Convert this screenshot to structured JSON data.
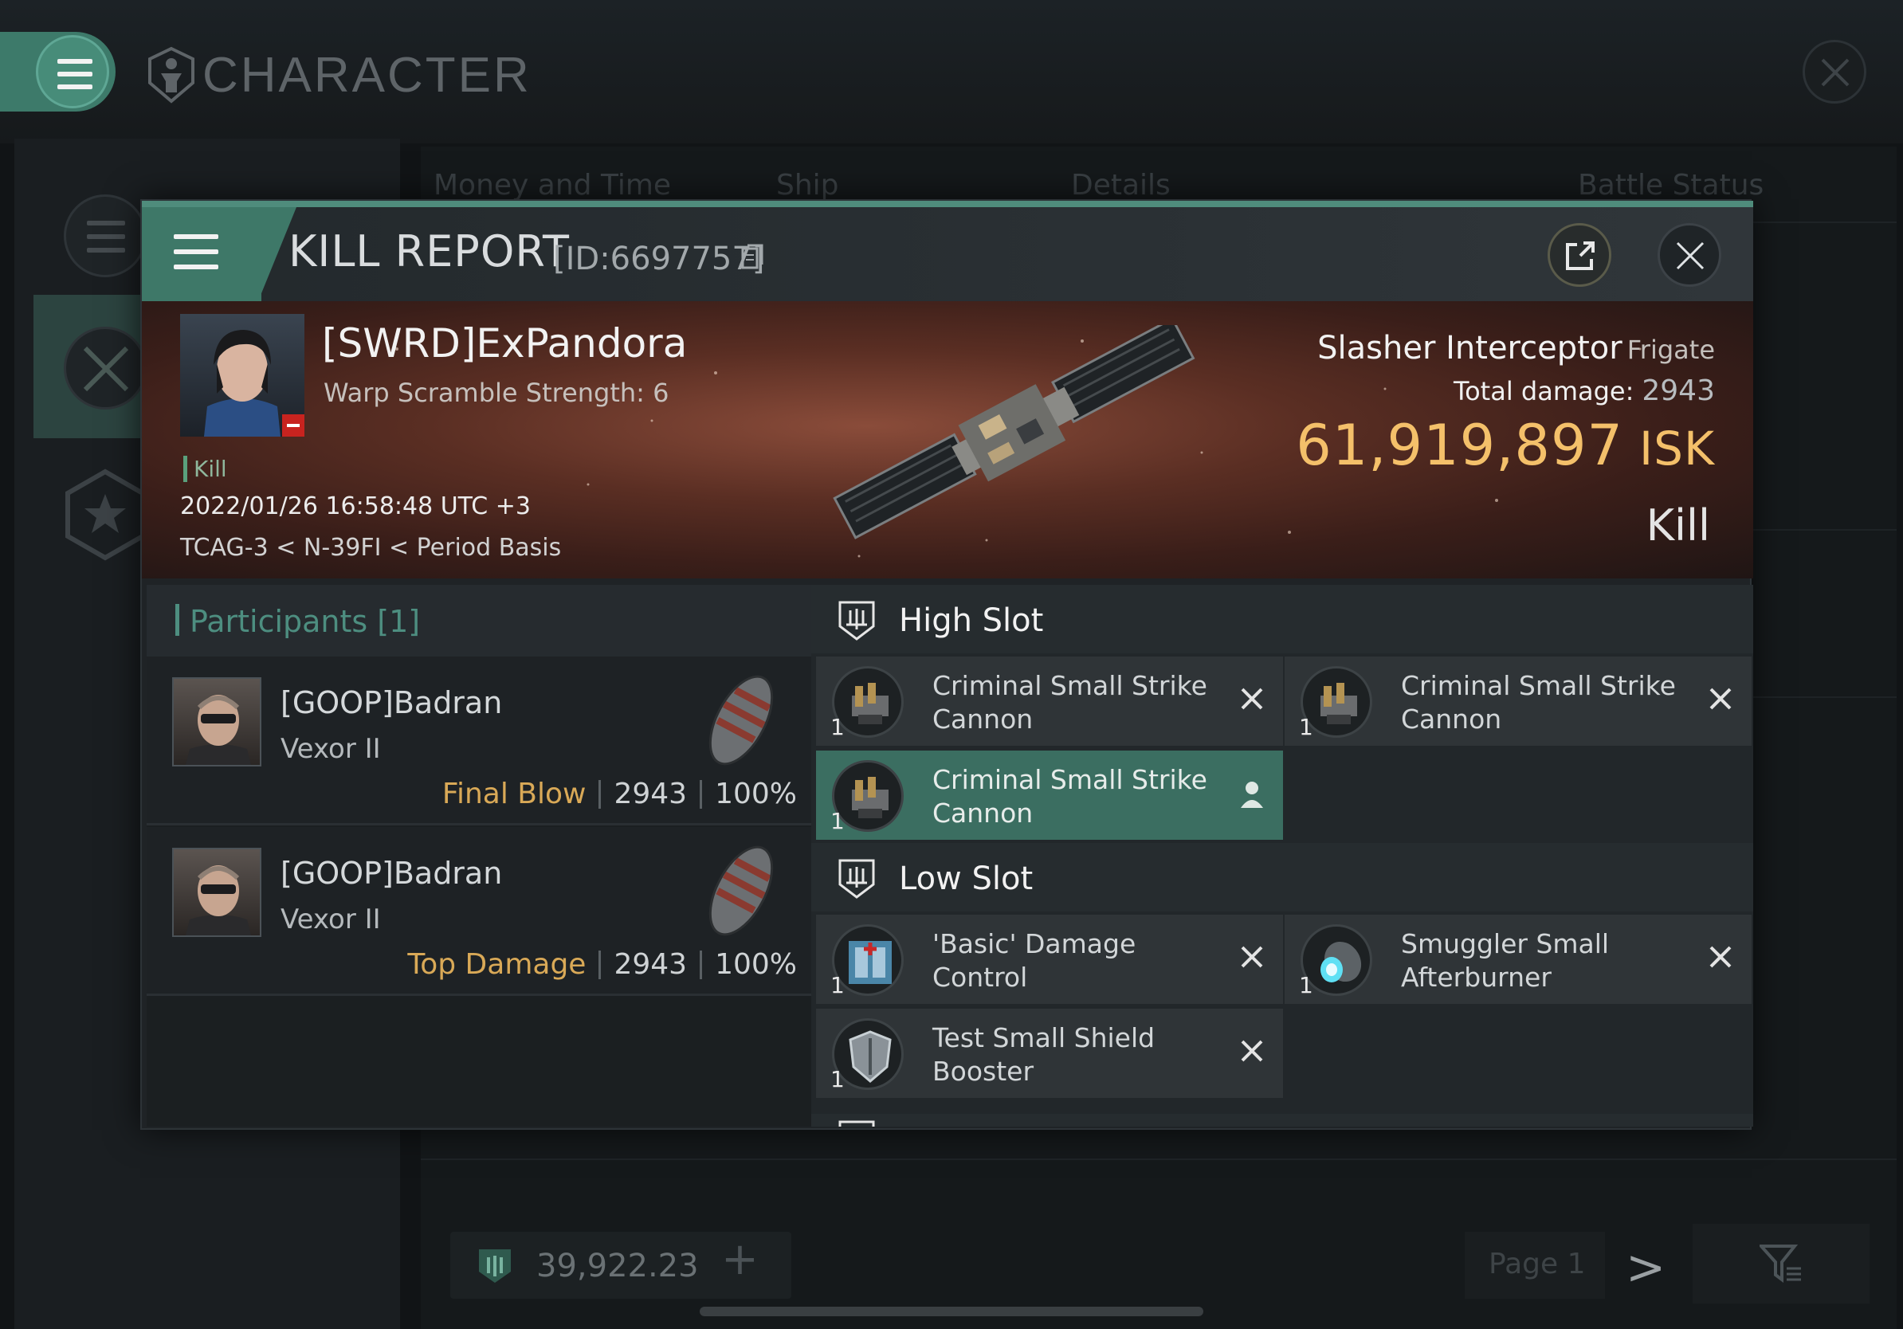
{
  "background": {
    "title": "CHARACTER",
    "columns": [
      "Money and Time",
      "Ship",
      "Details",
      "Battle Status"
    ],
    "wallet": "39,922.23",
    "page_label": "Page 1"
  },
  "kill_report": {
    "title": "KILL REPORT",
    "id_text": "[ID:6697757]",
    "victim": {
      "name": "[SWRD]ExPandora",
      "detail": "Warp Scramble Strength: 6",
      "tag": "Kill",
      "datetime": "2022/01/26 16:58:48 UTC +3",
      "location": "TCAG-3 < N-39FI < Period Basis"
    },
    "ship": {
      "name": "Slasher Interceptor",
      "class": "Frigate",
      "total_damage_label": "Total damage:",
      "total_damage": "2943",
      "isk_value": "61,919,897",
      "isk_unit": "ISK",
      "result": "Kill"
    },
    "participants": {
      "header": "Participants [1]",
      "rows": [
        {
          "name": "[GOOP]Badran",
          "ship": "Vexor II",
          "label": "Final Blow",
          "damage": "2943",
          "percent": "100%"
        },
        {
          "name": "[GOOP]Badran",
          "ship": "Vexor II",
          "label": "Top Damage",
          "damage": "2943",
          "percent": "100%"
        }
      ]
    },
    "slots": {
      "high": {
        "title": "High Slot",
        "items": [
          {
            "qty": "1",
            "name": "Criminal Small Strike Cannon"
          },
          {
            "qty": "1",
            "name": "Criminal Small Strike Cannon"
          },
          {
            "qty": "1",
            "name": "Criminal Small Strike Cannon"
          }
        ]
      },
      "low": {
        "title": "Low Slot",
        "items": [
          {
            "qty": "1",
            "name": "'Basic' Damage Control"
          },
          {
            "qty": "1",
            "name": "Smuggler Small Afterburner"
          },
          {
            "qty": "1",
            "name": "Test Small Shield Booster"
          }
        ]
      }
    }
  },
  "colors": {
    "accent": "#4f8c7c",
    "isk": "#f4c06a",
    "final_blow": "#d9a957",
    "highlight_item": "#3b6e61"
  }
}
